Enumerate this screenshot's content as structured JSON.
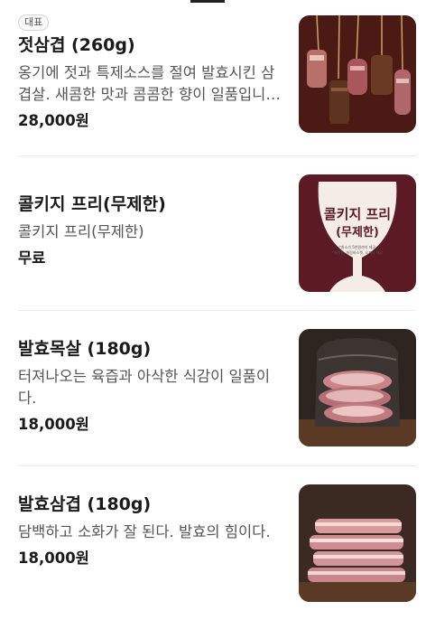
{
  "menu": {
    "items": [
      {
        "badge": "대표",
        "name": "젓삼겹 (260g)",
        "desc": "옹기에 젓과 특제소스를 절여 발효시킨 삼겹살. 새콤한 맛과 콤콤한 향이 일품입니다.",
        "price": "28,000원"
      },
      {
        "name": "콜키지 프리(무제한)",
        "desc": "콜키지 프리(무제한)",
        "price": "무료",
        "image": {
          "title_line1": "콜키지 프리",
          "title_line2": "(무제한)",
          "note_line1": "*최소가 5천원까지 제공",
          "note_line2": "*와인잔, 칠링바스켓, 오프너 제공"
        }
      },
      {
        "name": "발효목살 (180g)",
        "desc": "터져나오는 육즙과 아삭한 식감이 일품이다.",
        "price": "18,000원"
      },
      {
        "name": "발효삼겹 (180g)",
        "desc": "담백하고 소화가 잘 된다. 발효의 힘이다.",
        "price": "18,000원"
      }
    ]
  },
  "colors": {
    "wine_bg": "#5c1a24",
    "meat_pink": "#c9848a",
    "board_brown": "#5a3a24"
  }
}
